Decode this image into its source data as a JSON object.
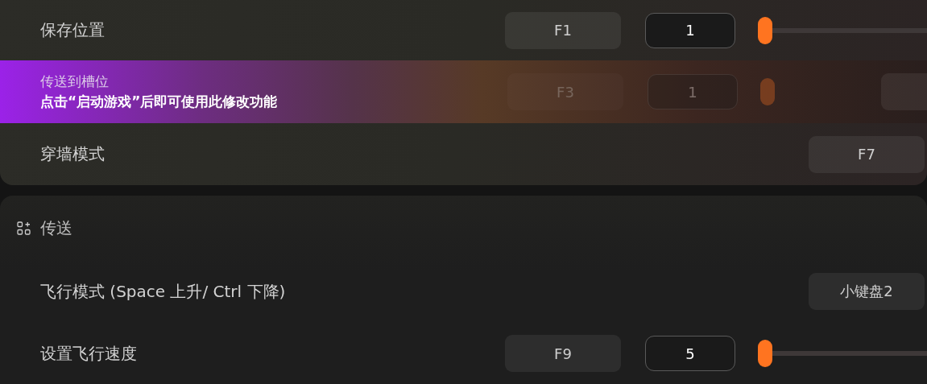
{
  "sections": [
    {
      "rows": [
        {
          "kind": "slider",
          "label": "保存位置",
          "key": "F1",
          "value": "1",
          "level": 0,
          "disabled": false
        },
        {
          "kind": "slider",
          "label": "传送到槽位",
          "key": "F3",
          "value": "1",
          "level": 0,
          "disabled": true,
          "notice": "点击“启动游戏”后即可使用此修改功能",
          "extra_button": true
        },
        {
          "kind": "key",
          "label": "穿墙模式",
          "key": "F7",
          "disabled": false
        }
      ]
    },
    {
      "title": "传送",
      "rows": [
        {
          "kind": "key",
          "label": "飞行模式 (Space 上升/ Ctrl 下降)",
          "key": "小键盘2",
          "disabled": false
        },
        {
          "kind": "slider",
          "label": "设置飞行速度",
          "key": "F9",
          "value": "5",
          "level": 0,
          "disabled": false
        }
      ]
    }
  ]
}
